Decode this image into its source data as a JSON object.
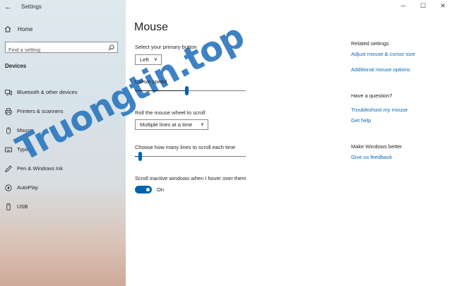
{
  "window": {
    "back_icon": "back-arrow-icon",
    "title": "Settings",
    "controls": [
      "─",
      "☐",
      "✕"
    ]
  },
  "sidebar": {
    "home_label": "Home",
    "search_placeholder": "Find a setting",
    "section": "Devices",
    "items": [
      {
        "label": "Bluetooth & other devices",
        "icon": "bluetooth-devices-icon"
      },
      {
        "label": "Printers & scanners",
        "icon": "printer-icon"
      },
      {
        "label": "Mouse",
        "icon": "mouse-icon"
      },
      {
        "label": "Typing",
        "icon": "keyboard-icon"
      },
      {
        "label": "Pen & Windows Ink",
        "icon": "pen-icon"
      },
      {
        "label": "AutoPlay",
        "icon": "autoplay-icon"
      },
      {
        "label": "USB",
        "icon": "usb-icon"
      }
    ]
  },
  "watermark": "Truongtin.top",
  "main": {
    "title": "Mouse",
    "primary_button": {
      "label": "Select your primary button",
      "value": "Left"
    },
    "cursor_speed": {
      "label": "Cursor speed",
      "level": 0.47
    },
    "wheel": {
      "label": "Roll the mouse wheel to scroll",
      "value": "Multiple lines at a time"
    },
    "lines": {
      "label": "Choose how many lines to scroll each time",
      "level": 0.03
    },
    "inactive": {
      "label": "Scroll inactive windows when I hover over them",
      "state": "On"
    }
  },
  "aside": {
    "related": {
      "heading": "Related settings",
      "links": [
        "Adjust mouse & cursor size",
        "Additional mouse options"
      ]
    },
    "question": {
      "heading": "Have a question?",
      "links": [
        "Troubleshoot my mouse",
        "Get help"
      ]
    },
    "better": {
      "heading": "Make Windows better",
      "links": [
        "Give us feedback"
      ]
    }
  },
  "colors": {
    "accent": "#0063b1",
    "link": "#0b67b8"
  }
}
